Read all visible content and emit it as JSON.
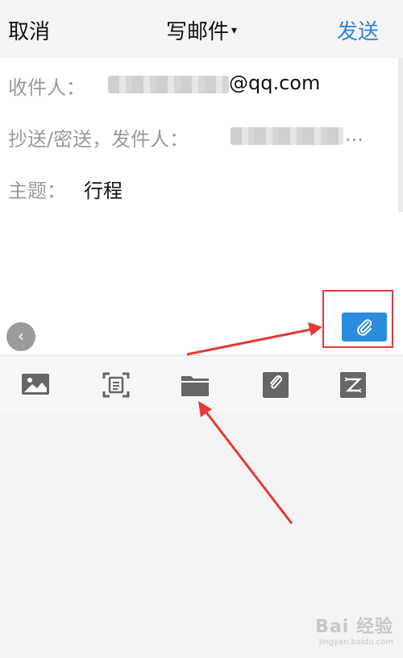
{
  "header": {
    "cancel_label": "取消",
    "title": "写邮件",
    "caret": "▾",
    "send_label": "发送"
  },
  "fields": {
    "to_label": "收件人：",
    "to_value_suffix": "@qq.com",
    "cc_label": "抄送/密送，发件人：",
    "cc_ellipsis": "...",
    "subject_label": "主题：",
    "subject_value": "行程"
  },
  "controls": {
    "collapse_glyph": "‹"
  },
  "toolbar": {
    "icons": [
      "image-icon",
      "scan-document-icon",
      "folder-icon",
      "note-icon",
      "text-transform-icon"
    ]
  },
  "watermark": {
    "text": "Bai 经验",
    "sub": "jingyan.baidu.com"
  },
  "colors": {
    "accent": "#2a8cde",
    "send": "#2f86d3",
    "annotation": "#e53935"
  }
}
